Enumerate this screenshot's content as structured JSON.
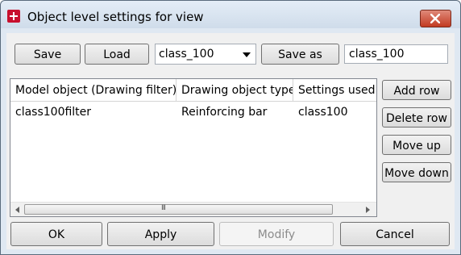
{
  "window": {
    "title": "Object level settings for view",
    "close_icon": "close-icon",
    "app_icon": "app-icon"
  },
  "toolbar": {
    "save_label": "Save",
    "load_label": "Load",
    "combo_value": "class_100",
    "save_as_label": "Save as",
    "save_as_value": "class_100"
  },
  "grid": {
    "columns": [
      "Model object (Drawing filter)",
      "Drawing object type",
      "Settings used"
    ],
    "rows": [
      [
        "class100filter",
        "Reinforcing bar",
        "class100"
      ]
    ],
    "scroll_grip": "III"
  },
  "side_buttons": {
    "add_row": "Add row",
    "delete_row": "Delete row",
    "move_up": "Move up",
    "move_down": "Move down"
  },
  "bottom_buttons": {
    "ok": "OK",
    "apply": "Apply",
    "modify": "Modify",
    "cancel": "Cancel"
  }
}
